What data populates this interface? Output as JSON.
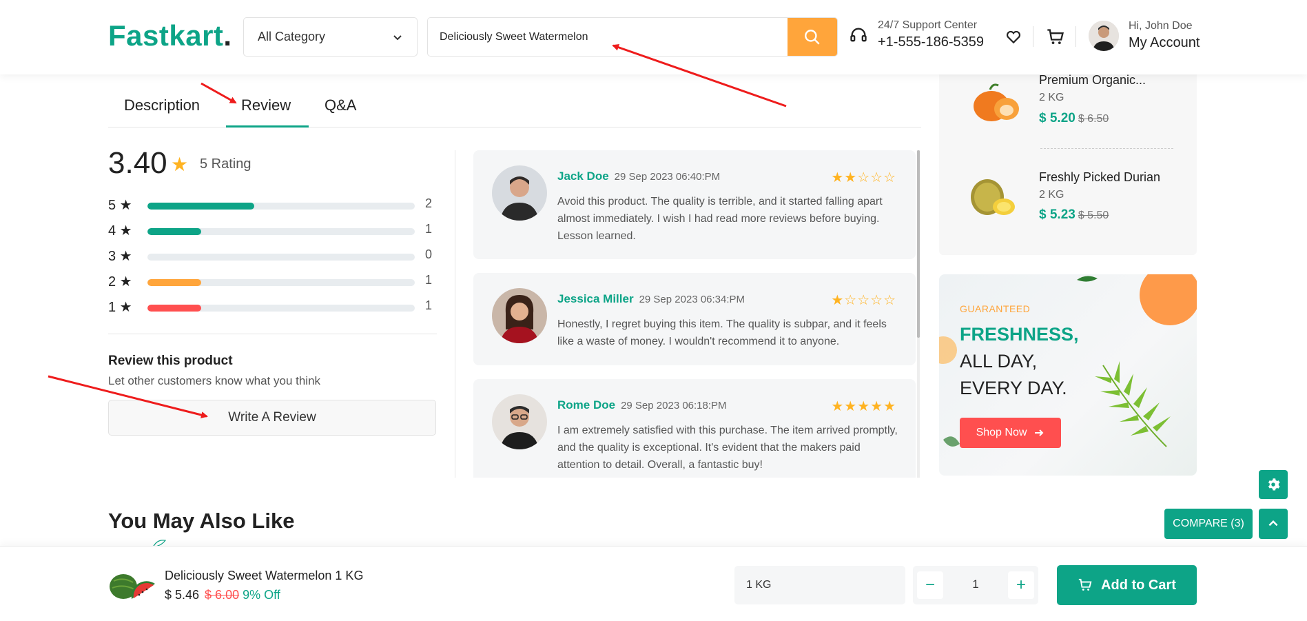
{
  "header": {
    "logo_main": "Fastkart",
    "logo_dot": ".",
    "category": "All Category",
    "search_value": "Deliciously Sweet Watermelon",
    "support_title": "24/7 Support Center",
    "support_phone": "+1-555-186-5359",
    "greeting": "Hi, John Doe",
    "account": "My Account"
  },
  "tabs": {
    "description": "Description",
    "review": "Review",
    "qa": "Q&A"
  },
  "summary": {
    "average": "3.40",
    "rating_text": "5 Rating",
    "rows": [
      {
        "stars": "5",
        "count": "2",
        "fraction": 0.4,
        "color": "#0da487"
      },
      {
        "stars": "4",
        "count": "1",
        "fraction": 0.2,
        "color": "#0da487"
      },
      {
        "stars": "3",
        "count": "0",
        "fraction": 0.0,
        "color": "#0da487"
      },
      {
        "stars": "2",
        "count": "1",
        "fraction": 0.2,
        "color": "#ffa53b"
      },
      {
        "stars": "1",
        "count": "1",
        "fraction": 0.2,
        "color": "#ff4f4f"
      }
    ],
    "review_title": "Review this product",
    "review_sub": "Let other customers know what you think",
    "write_button": "Write A Review"
  },
  "reviews": [
    {
      "name": "Jack Doe",
      "date": "29 Sep 2023 06:40:PM",
      "stars": 2,
      "text": "Avoid this product. The quality is terrible, and it started falling apart almost immediately. I wish I had read more reviews before buying. Lesson learned."
    },
    {
      "name": "Jessica Miller",
      "date": "29 Sep 2023 06:34:PM",
      "stars": 1,
      "text": "Honestly, I regret buying this item. The quality is subpar, and it feels like a waste of money. I wouldn't recommend it to anyone."
    },
    {
      "name": "Rome Doe",
      "date": "29 Sep 2023 06:18:PM",
      "stars": 5,
      "text": "I am extremely satisfied with this purchase. The item arrived promptly, and the quality is exceptional. It's evident that the makers paid attention to detail. Overall, a fantastic buy!"
    }
  ],
  "sidebar": {
    "products": [
      {
        "name": "Premium Organic...",
        "qty": "2 KG",
        "price": "$ 5.20",
        "old": "$ 6.50"
      },
      {
        "name": "Freshly Picked Durian",
        "qty": "2 KG",
        "price": "$ 5.23",
        "old": "$ 5.50"
      }
    ]
  },
  "banner": {
    "eyebrow": "GUARANTEED",
    "headline_bold": "FRESHNESS,",
    "headline_rest": " ALL DAY, EVERY DAY.",
    "button": "Shop Now"
  },
  "floating": {
    "compare": "COMPARE (3)"
  },
  "section_title": "You May Also Like",
  "sticky": {
    "product": "Deliciously Sweet Watermelon 1 KG",
    "price": "$ 5.46",
    "old_price": "$ 6.00",
    "discount": "9% Off",
    "unit": "1 KG",
    "qty": "1",
    "add_to_cart": "Add to Cart"
  },
  "colors": {
    "accent": "#0da487",
    "orange": "#ffa53b",
    "red": "#ff4f4f",
    "star": "#ffb321"
  }
}
